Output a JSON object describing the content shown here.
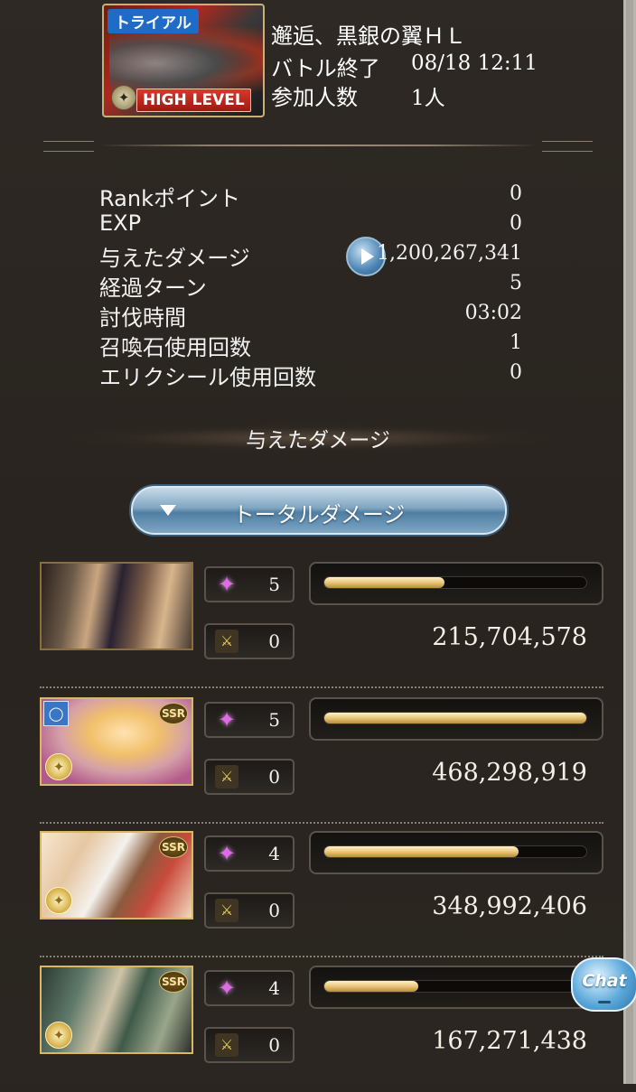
{
  "header": {
    "trial_tag": "トライアル",
    "level_tag": "HIGH LEVEL",
    "quest_name": "邂逅、黒銀の翼ＨＬ",
    "battle_end_label": "バトル終了",
    "battle_end_time": "08/18 12:11",
    "participants_label": "参加人数",
    "participants_value": "1人"
  },
  "stats": [
    {
      "label": "Rankポイント",
      "value": "0"
    },
    {
      "label": "EXP",
      "value": "0"
    },
    {
      "label": "与えたダメージ",
      "value": "1,200,267,341"
    },
    {
      "label": "経過ターン",
      "value": "5"
    },
    {
      "label": "討伐時間",
      "value": "03:02"
    },
    {
      "label": "召喚石使用回数",
      "value": "1"
    },
    {
      "label": "エリクシール使用回数",
      "value": "0"
    }
  ],
  "damage_section": {
    "title": "与えたダメージ",
    "dropdown_label": "トータルダメージ"
  },
  "characters": [
    {
      "turns": "5",
      "ougi": "0",
      "damage": "215,704,578",
      "fill": 0.46,
      "ssr": false
    },
    {
      "turns": "5",
      "ougi": "0",
      "damage": "468,298,919",
      "fill": 1.0,
      "ssr": true,
      "ssr_label": "SSR"
    },
    {
      "turns": "4",
      "ougi": "0",
      "damage": "348,992,406",
      "fill": 0.74,
      "ssr": true,
      "ssr_label": "SSR"
    },
    {
      "turns": "4",
      "ougi": "0",
      "damage": "167,271,438",
      "fill": 0.36,
      "ssr": true,
      "ssr_label": "SSR"
    }
  ],
  "chat_label": "Chat",
  "colors": {
    "bar_fill": "#e9c67a",
    "background": "#2a2520",
    "dropdown": "#7fa5c1"
  }
}
